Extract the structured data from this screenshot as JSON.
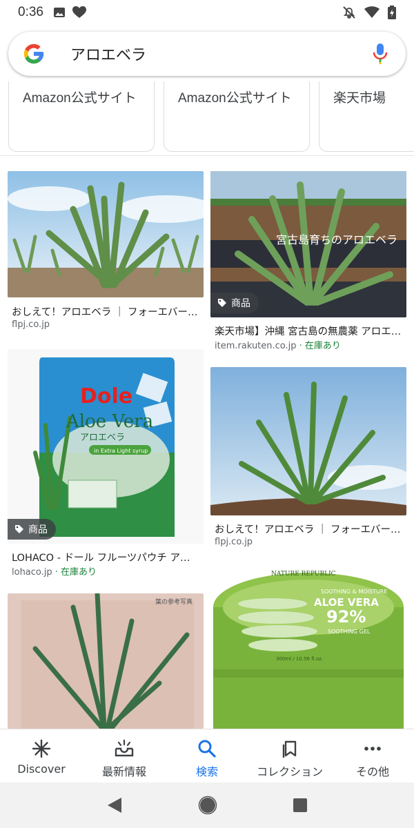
{
  "status_bar": {
    "time": "0:36"
  },
  "search": {
    "query": "アロエベラ"
  },
  "ads": [
    {
      "label": "Amazon公式サイト"
    },
    {
      "label": "Amazon公式サイト"
    },
    {
      "label": "楽天市場"
    }
  ],
  "results": [
    {
      "title": "おしえて！アロエベラ ｜ フォーエバーリビング",
      "source": "flpj.co.jp",
      "stock": "",
      "badge": ""
    },
    {
      "title": "楽天市場】沖縄 宮古島の無農薬 アロエベラ",
      "source": "item.rakuten.co.jp",
      "stock": " · 在庫あり",
      "badge": "商品",
      "overlay_text": "宮古島育ちのアロエベラ"
    },
    {
      "title": "LOHACO - ドール フルーツパウチ アロエベラ",
      "source": "lohaco.jp",
      "stock": " · 在庫あり",
      "badge": "商品",
      "package": {
        "brand": "Dole",
        "name": "Aloe Vera",
        "name_jp": "アロエベラ",
        "sub": "in Extra Light syrup"
      }
    },
    {
      "title": "おしえて！アロエベラ ｜ フォーエバーリビング",
      "source": "flpj.co.jp",
      "stock": "",
      "badge": ""
    },
    {
      "title": "",
      "source": "",
      "stock": "",
      "badge": "",
      "caption": "葉の参考写真"
    },
    {
      "title": "",
      "source": "",
      "stock": "",
      "badge": "",
      "jar": {
        "brand": "NATURE REPUBLIC",
        "line": "SOOTHING & MOISTURE",
        "name": "ALOE VERA",
        "percent": "92%",
        "gel": "SOOTHING GEL",
        "size": "300ml / 10.56 fl.oz."
      }
    }
  ],
  "bottom_nav": [
    {
      "label": "Discover",
      "icon": "asterisk-icon",
      "active": false
    },
    {
      "label": "最新情報",
      "icon": "updates-icon",
      "active": false
    },
    {
      "label": "検索",
      "icon": "search-icon",
      "active": true
    },
    {
      "label": "コレクション",
      "icon": "bookmark-icon",
      "active": false
    },
    {
      "label": "その他",
      "icon": "more-icon",
      "active": false
    }
  ],
  "colors": {
    "accent": "#1a73e8",
    "stock_green": "#188038",
    "google_blue": "#4285F4",
    "google_red": "#EA4335",
    "google_yellow": "#FBBC05",
    "google_green": "#34A853"
  }
}
